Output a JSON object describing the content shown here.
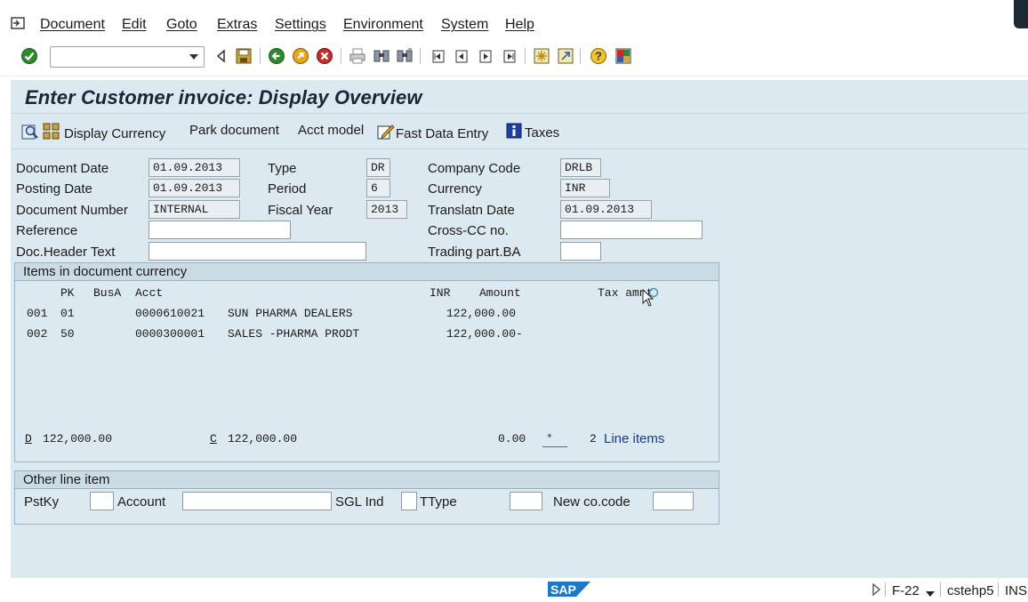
{
  "menu": {
    "items": [
      "Document",
      "Edit",
      "Goto",
      "Extras",
      "Settings",
      "Environment",
      "System",
      "Help"
    ]
  },
  "toolbar": {
    "command_field_value": "",
    "icons": [
      "enter-icon",
      "back-icon",
      "save-icon",
      "exit-icon",
      "cancel-icon",
      "print-icon",
      "find-icon",
      "find-next-icon",
      "first-page-icon",
      "previous-page-icon",
      "next-page-icon",
      "last-page-icon",
      "new-session-icon",
      "shortcut-icon",
      "help-icon",
      "customize-layout-icon"
    ]
  },
  "page": {
    "title": "Enter Customer invoice: Display Overview"
  },
  "app_toolbar": {
    "display_currency": "Display Currency",
    "park_document": "Park document",
    "acct_model": "Acct model",
    "fast_data_entry": "Fast Data Entry",
    "taxes": "Taxes"
  },
  "header": {
    "document_date_label": "Document Date",
    "document_date": "01.09.2013",
    "posting_date_label": "Posting Date",
    "posting_date": "01.09.2013",
    "document_number_label": "Document Number",
    "document_number": "INTERNAL",
    "reference_label": "Reference",
    "reference": "",
    "doc_header_text_label": "Doc.Header Text",
    "doc_header_text": "",
    "type_label": "Type",
    "type": "DR",
    "period_label": "Period",
    "period": "6",
    "fiscal_year_label": "Fiscal Year",
    "fiscal_year": "2013",
    "company_code_label": "Company Code",
    "company_code": "DRLB",
    "currency_label": "Currency",
    "currency": "INR",
    "translatn_date_label": "Translatn Date",
    "translatn_date": "01.09.2013",
    "cross_cc_label": "Cross-CC no.",
    "cross_cc": "",
    "trading_part_label": "Trading part.BA",
    "trading_part": ""
  },
  "items_group": {
    "title": "Items in document currency",
    "columns": {
      "pk": "PK",
      "busa": "BusA",
      "acct": "Acct",
      "currency": "INR",
      "amount": "Amount",
      "tax": "Tax amnt"
    },
    "rows": [
      {
        "item": "001",
        "pk": "01",
        "acct": "0000610021",
        "name": "SUN PHARMA DEALERS",
        "amount": "122,000.00"
      },
      {
        "item": "002",
        "pk": "50",
        "acct": "0000300001",
        "name": "SALES -PHARMA PRODT",
        "amount": "122,000.00-"
      }
    ],
    "totals": {
      "debit_label": "D",
      "debit": "122,000.00",
      "credit_label": "C",
      "credit": "122,000.00",
      "balance": "0.00",
      "balance_marker": "*",
      "line_items_count": "2",
      "line_items_label": "Line items"
    }
  },
  "other_line_item": {
    "title": "Other line item",
    "pstky_label": "PstKy",
    "pstky": "",
    "account_label": "Account",
    "account": "",
    "sgl_ind_label": "SGL Ind",
    "sgl_ind": "",
    "ttype_label": "TType",
    "ttype": "",
    "new_co_code_label": "New co.code",
    "new_co_code": ""
  },
  "status_bar": {
    "logo": "SAP",
    "transaction": "F-22",
    "server": "cstehp5",
    "mode": "INS"
  },
  "colors": {
    "workarea": "#dde9f0",
    "group_header": "#cbdbe6",
    "accent_green": "#2f8a2f",
    "link_blue": "#1a3a8a"
  }
}
